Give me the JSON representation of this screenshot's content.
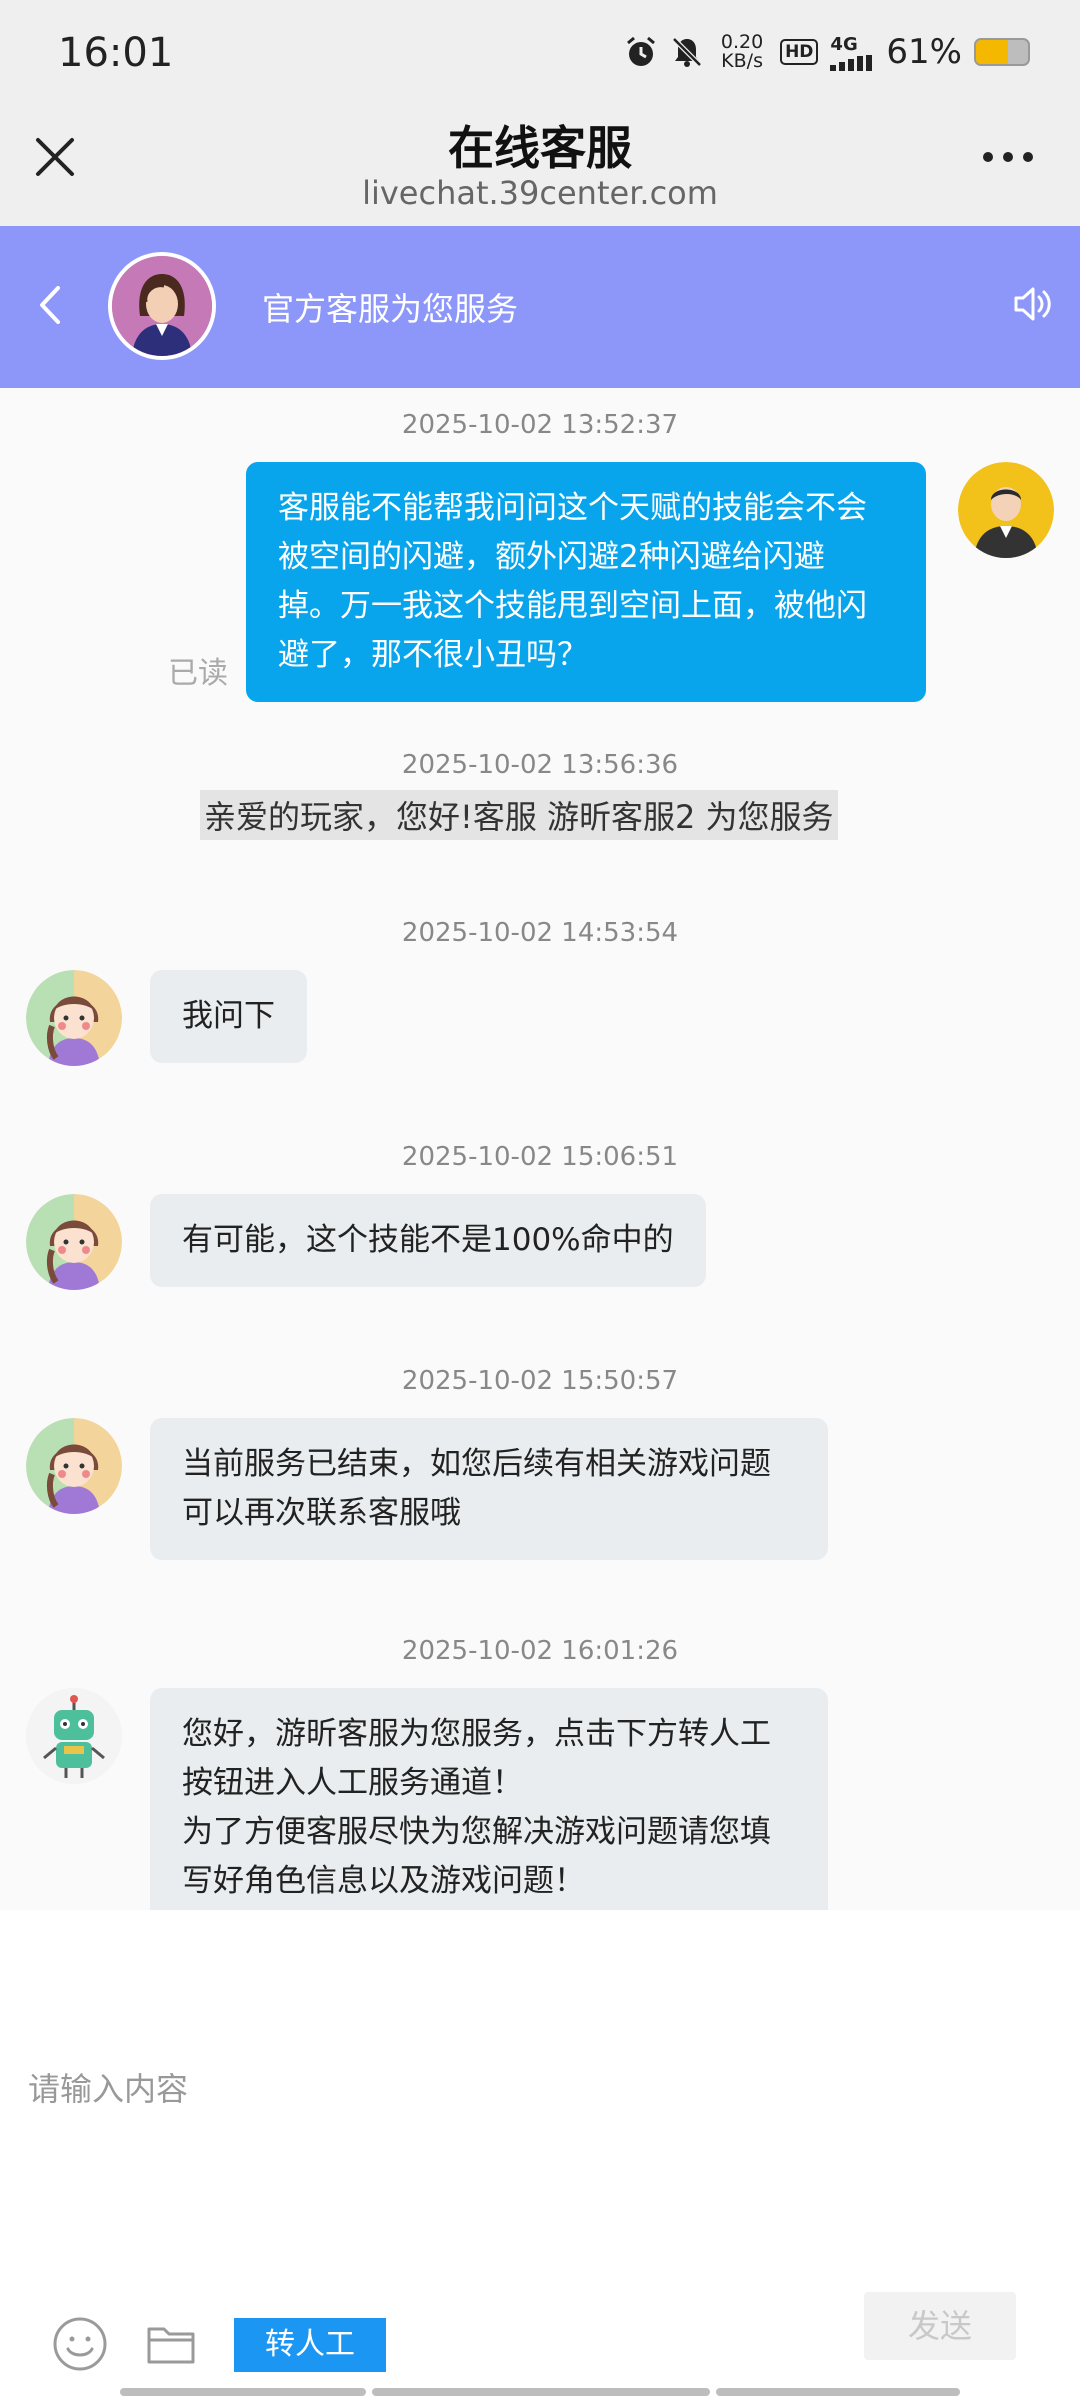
{
  "status_bar": {
    "time": "16:01",
    "speed_value": "0.20",
    "speed_unit": "KB/s",
    "hd": "HD",
    "network": "4G",
    "battery_text": "61%",
    "battery_level": 0.61,
    "icons": [
      "alarm-icon",
      "mute-icon",
      "signal-icon",
      "battery-icon"
    ]
  },
  "title_bar": {
    "title": "在线客服",
    "subtitle": "livechat.39center.com",
    "icons": [
      "close-icon",
      "more-icon"
    ]
  },
  "chat_header": {
    "title": "官方客服为您服务",
    "icons": [
      "back-icon",
      "speaker-icon"
    ],
    "color": "#8d97fa"
  },
  "messages": [
    {
      "type": "outgoing",
      "time": "2025-10-02 13:52:37",
      "text": "客服能不能帮我问问这个天赋的技能会不会\n被空间的闪避，额外闪避2种闪避给闪避\n掉。万一我这个技能甩到空间上面，被他闪\n避了，那不很小丑吗？",
      "status": "已读"
    },
    {
      "type": "system",
      "time": "2025-10-02 13:56:36",
      "text": "亲爱的玩家，您好!客服 游昕客服2 为您服务"
    },
    {
      "type": "incoming",
      "time": "2025-10-02 14:53:54",
      "text": "我问下"
    },
    {
      "type": "incoming",
      "time": "2025-10-02 15:06:51",
      "text": "有可能，这个技能不是100%命中的"
    },
    {
      "type": "incoming",
      "time": "2025-10-02 15:50:57",
      "text": "当前服务已结束，如您后续有相关游戏问题\n可以再次联系客服哦"
    },
    {
      "type": "bot",
      "time": "2025-10-02 16:01:26",
      "text": "您好，游昕客服为您服务，点击下方转人工\n按钮进入人工服务通道！\n为了方便客服尽快为您解决游戏问题请您填\n写好角色信息以及游戏问题！"
    }
  ],
  "input": {
    "placeholder": "请输入内容",
    "human_button": "转人工",
    "send_button": "发送",
    "icons": [
      "emoji-icon",
      "folder-icon"
    ]
  },
  "colors": {
    "outgoing_bubble": "#08a4ec",
    "incoming_bubble": "#e9edef",
    "human_button": "#1c96f3"
  }
}
